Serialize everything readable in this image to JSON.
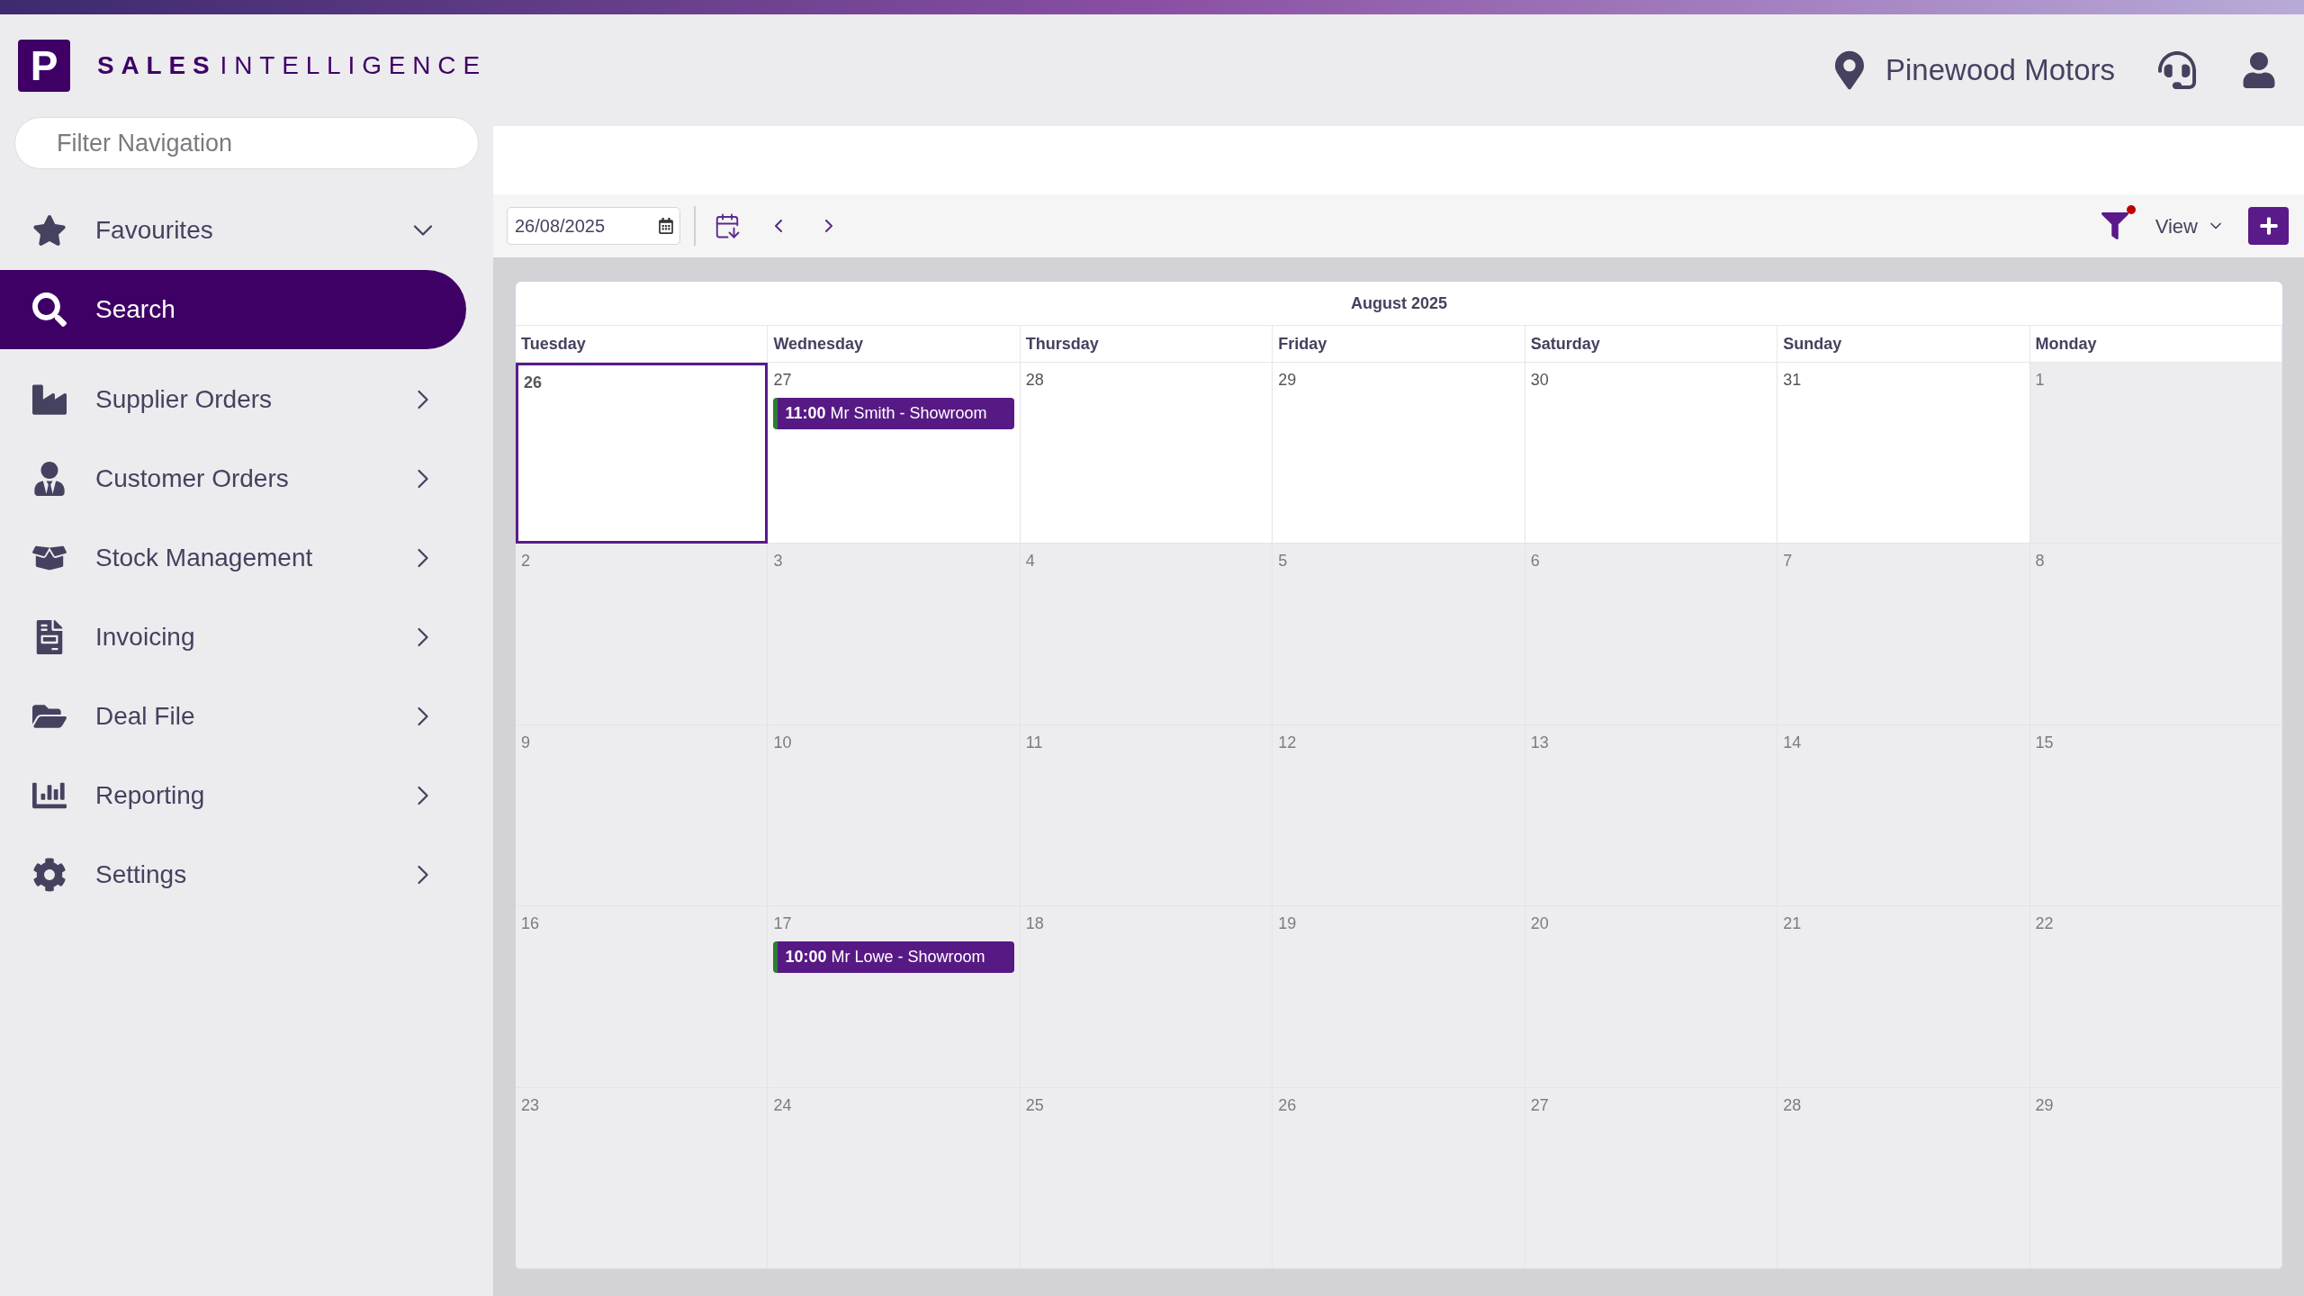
{
  "brand": {
    "mark": "P",
    "bold": "SALES",
    "light": "INTELLIGENCE"
  },
  "header": {
    "location": "Pinewood Motors"
  },
  "sidebar": {
    "filter": {
      "placeholder": "Filter Navigation"
    },
    "items": [
      {
        "label": "Favourites",
        "kind": "section",
        "selected": false
      },
      {
        "label": "Search",
        "kind": "link",
        "selected": true
      },
      {
        "label": "Supplier Orders",
        "kind": "menu",
        "selected": false
      },
      {
        "label": "Customer Orders",
        "kind": "menu",
        "selected": false
      },
      {
        "label": "Stock Management",
        "kind": "menu",
        "selected": false
      },
      {
        "label": "Invoicing",
        "kind": "menu",
        "selected": false
      },
      {
        "label": "Deal File",
        "kind": "menu",
        "selected": false
      },
      {
        "label": "Reporting",
        "kind": "menu",
        "selected": false
      },
      {
        "label": "Settings",
        "kind": "menu",
        "selected": false
      }
    ]
  },
  "toolbar": {
    "date": "26/08/2025",
    "filter_active": true,
    "view": "View"
  },
  "calendar": {
    "title": "August 2025",
    "weekdays": [
      "Tuesday",
      "Wednesday",
      "Thursday",
      "Friday",
      "Saturday",
      "Sunday",
      "Monday"
    ],
    "weeks": [
      {
        "days": [
          {
            "label": "26",
            "in_month": true,
            "selected": true
          },
          {
            "label": "27",
            "in_month": true,
            "selected": false,
            "events": [
              {
                "time": "11:00",
                "title": "Mr Smith - Showroom",
                "color": "#2e7d32"
              }
            ]
          },
          {
            "label": "28",
            "in_month": true,
            "selected": false
          },
          {
            "label": "29",
            "in_month": true,
            "selected": false
          },
          {
            "label": "30",
            "in_month": true,
            "selected": false
          },
          {
            "label": "31",
            "in_month": true,
            "selected": false
          },
          {
            "label": "1",
            "in_month": false,
            "selected": false
          }
        ]
      },
      {
        "days": [
          {
            "label": "2",
            "in_month": false,
            "selected": false
          },
          {
            "label": "3",
            "in_month": false,
            "selected": false
          },
          {
            "label": "4",
            "in_month": false,
            "selected": false
          },
          {
            "label": "5",
            "in_month": false,
            "selected": false
          },
          {
            "label": "6",
            "in_month": false,
            "selected": false
          },
          {
            "label": "7",
            "in_month": false,
            "selected": false
          },
          {
            "label": "8",
            "in_month": false,
            "selected": false
          }
        ]
      },
      {
        "days": [
          {
            "label": "9",
            "in_month": false,
            "selected": false
          },
          {
            "label": "10",
            "in_month": false,
            "selected": false
          },
          {
            "label": "11",
            "in_month": false,
            "selected": false
          },
          {
            "label": "12",
            "in_month": false,
            "selected": false
          },
          {
            "label": "13",
            "in_month": false,
            "selected": false
          },
          {
            "label": "14",
            "in_month": false,
            "selected": false
          },
          {
            "label": "15",
            "in_month": false,
            "selected": false
          }
        ]
      },
      {
        "days": [
          {
            "label": "16",
            "in_month": false,
            "selected": false
          },
          {
            "label": "17",
            "in_month": false,
            "selected": false,
            "events": [
              {
                "time": "10:00",
                "title": "Mr Lowe - Showroom",
                "color": "#2e7d32"
              }
            ]
          },
          {
            "label": "18",
            "in_month": false,
            "selected": false
          },
          {
            "label": "19",
            "in_month": false,
            "selected": false
          },
          {
            "label": "20",
            "in_month": false,
            "selected": false
          },
          {
            "label": "21",
            "in_month": false,
            "selected": false
          },
          {
            "label": "22",
            "in_month": false,
            "selected": false
          }
        ]
      },
      {
        "days": [
          {
            "label": "23",
            "in_month": false,
            "selected": false
          },
          {
            "label": "24",
            "in_month": false,
            "selected": false
          },
          {
            "label": "25",
            "in_month": false,
            "selected": false
          },
          {
            "label": "26",
            "in_month": false,
            "selected": false
          },
          {
            "label": "27",
            "in_month": false,
            "selected": false
          },
          {
            "label": "28",
            "in_month": false,
            "selected": false
          },
          {
            "label": "29",
            "in_month": false,
            "selected": false
          }
        ]
      }
    ]
  }
}
